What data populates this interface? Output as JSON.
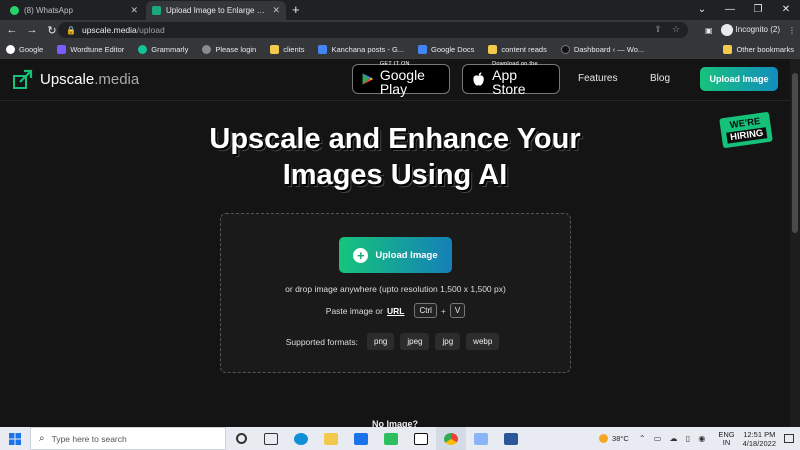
{
  "browser": {
    "tabs": [
      {
        "title": "(8) WhatsApp",
        "active": false,
        "icon": "whatsapp-icon",
        "color": "#25d366"
      },
      {
        "title": "Upload Image to Enlarge & Enha",
        "active": true,
        "icon": "upscale-icon",
        "color": "#1aa97c"
      }
    ],
    "new_tab": "+",
    "url_host": "upscale.media",
    "url_path": "/upload",
    "profile": "Incognito (2)",
    "bookmarks": [
      {
        "label": "Google",
        "icon": "google-icon",
        "color": "#ffffff"
      },
      {
        "label": "Wordtune Editor",
        "icon": "wordtune-icon",
        "color": "#7b5cff"
      },
      {
        "label": "Grammarly",
        "icon": "grammarly-icon",
        "color": "#15c39a"
      },
      {
        "label": "Please login",
        "icon": "globe-icon",
        "color": "#8a8a8a"
      },
      {
        "label": "clients",
        "icon": "folder-icon",
        "color": "#f2c94c"
      },
      {
        "label": "Kanchana posts - G...",
        "icon": "docs-icon",
        "color": "#4285f4"
      },
      {
        "label": "Google Docs",
        "icon": "docs-icon",
        "color": "#4285f4"
      },
      {
        "label": "content reads",
        "icon": "folder-icon",
        "color": "#f2c94c"
      },
      {
        "label": "Dashboard ‹ — Wo...",
        "icon": "wordpress-icon",
        "color": "#111111"
      }
    ],
    "other_bookmarks": "Other bookmarks"
  },
  "site": {
    "logo_main": "Upscale",
    "logo_dot": ".media",
    "google_play_small": "GET IT ON",
    "google_play_big": "Google Play",
    "app_store_small": "Download on the",
    "app_store_big": "App Store",
    "nav_features": "Features",
    "nav_blog": "Blog",
    "header_upload": "Upload Image",
    "hiring_line1": "WE'RE",
    "hiring_line2": "HIRING",
    "hero_line1": "Upscale and Enhance Your",
    "hero_line2": "Images Using AI",
    "upload_button": "Upload Image",
    "drop_hint": "or drop image anywhere (upto resolution 1,500 x 1,500 px)",
    "paste_label": "Paste image or",
    "paste_url": "URL",
    "key_ctrl": "Ctrl",
    "key_plus": "+",
    "key_v": "V",
    "formats_label": "Supported formats:",
    "formats": [
      "png",
      "jpeg",
      "jpg",
      "webp"
    ],
    "no_image": "No Image?"
  },
  "taskbar": {
    "search_placeholder": "Type here to search",
    "temperature": "38°C",
    "lang_1": "ENG",
    "lang_2": "IN",
    "time": "12:51 PM",
    "date": "4/18/2022"
  },
  "colors": {
    "accent_green": "#17c27c",
    "accent_blue": "#138dbe",
    "page_bg": "#141414"
  }
}
